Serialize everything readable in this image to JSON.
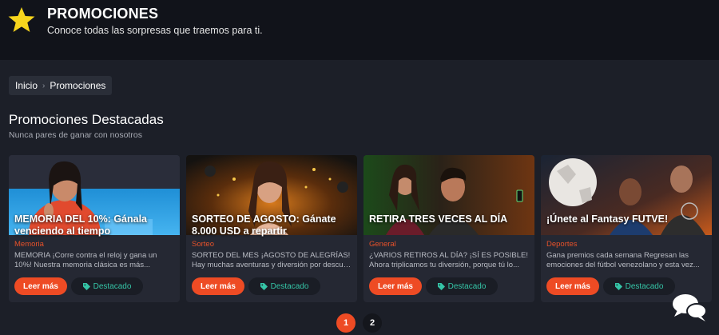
{
  "header": {
    "title": "PROMOCIONES",
    "subtitle": "Conoce todas las sorpresas que traemos para ti."
  },
  "breadcrumb": {
    "items": [
      "Inicio",
      "Promociones"
    ]
  },
  "section": {
    "title": "Promociones Destacadas",
    "subtitle": "Nunca pares de ganar con nosotros"
  },
  "cards": [
    {
      "title": "MEMORIA DEL 10%: Gánala venciendo al tiempo",
      "category": "Memoria",
      "desc_line1": "MEMORIA ¡Corre contra el reloj y gana un",
      "desc_line2": "10%! Nuestra memoria clásica es más...",
      "button": "Leer más",
      "badge": "Destacado",
      "icon": "woman-portrait-image"
    },
    {
      "title": "SORTEO DE AGOSTO: Gánate 8.000 USD a repartir",
      "category": "Sorteo",
      "desc_line1": "SORTEO DEL MES ¡AGOSTO DE ALEGRÍAS!",
      "desc_line2": "Hay muchas aventuras y diversión por descubr...",
      "button": "Leer más",
      "badge": "Destacado",
      "icon": "woman-confetti-image"
    },
    {
      "title": "RETIRA TRES VECES AL DÍA",
      "category": "General",
      "desc_line1": "¿VARIOS RETIROS AL DÍA? ¡SÍ ES POSIBLE!",
      "desc_line2": "Ahora triplicamos tu diversión, porque tú lo...",
      "button": "Leer más",
      "badge": "Destacado",
      "icon": "couple-phone-image"
    },
    {
      "title": "¡Únete al Fantasy FUTVE!",
      "category": "Deportes",
      "desc_line1": "Gana premios cada semana Regresan las",
      "desc_line2": "emociones del fútbol venezolano y esta vez...",
      "button": "Leer más",
      "badge": "Destacado",
      "icon": "football-players-image"
    }
  ],
  "pagination": {
    "pages": [
      "1",
      "2"
    ],
    "active": "1"
  },
  "colors": {
    "accent": "#ee4b24",
    "teal": "#35c5a7",
    "header_bg": "#11131a",
    "body_bg": "#1c1f28"
  }
}
